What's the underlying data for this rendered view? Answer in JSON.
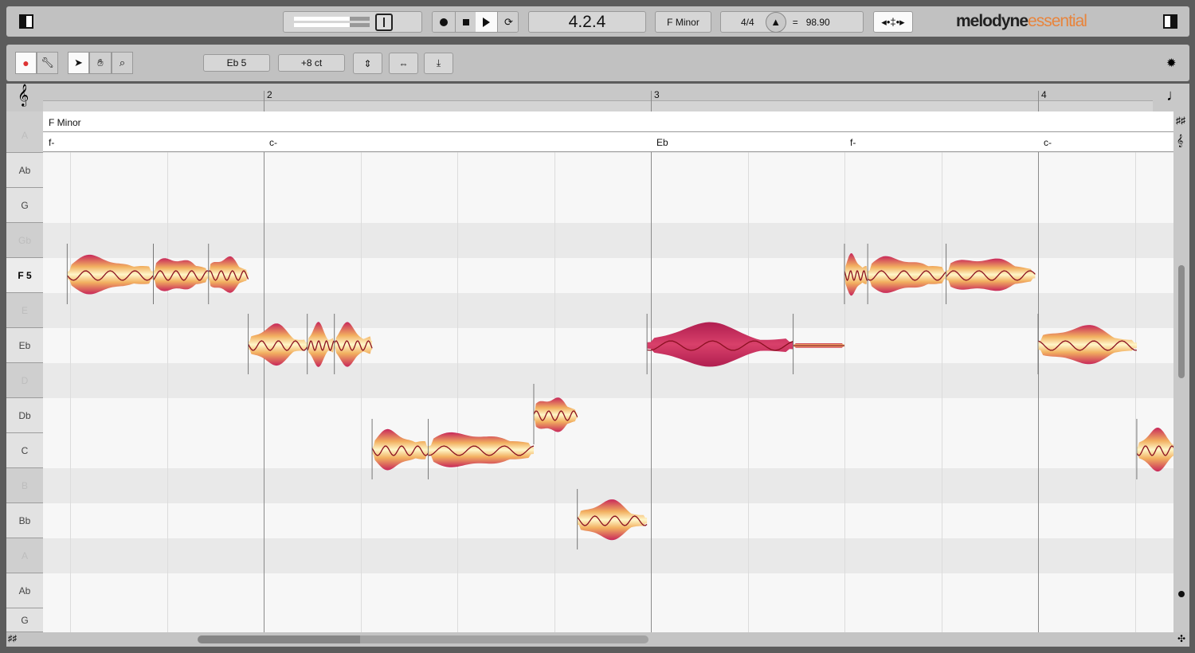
{
  "topbar": {
    "transport": {
      "record": "record-icon",
      "stop": "stop-icon",
      "play": "play-icon",
      "loop": "loop-icon"
    },
    "position": "4.2.4",
    "key": "F Minor",
    "time_signature": "4/4",
    "tempo_equals": "=",
    "tempo": "98.90",
    "logo_main": "melodyne",
    "logo_sub": "essential",
    "colors": {
      "logo_sub": "#e8843c"
    }
  },
  "toolbar": {
    "pitch_value": "Eb 5",
    "cents_value": "+8 ct",
    "tools": [
      "main-tool",
      "wrench-tool",
      "pointer-tool",
      "hand-tool",
      "zoom-tool",
      "pitch-snap",
      "time-handle",
      "amplitude"
    ]
  },
  "ruler": {
    "bars": [
      {
        "label": "2",
        "beat": 4
      },
      {
        "label": "3",
        "beat": 8
      },
      {
        "label": "4",
        "beat": 12
      }
    ]
  },
  "scale_label": "F Minor",
  "chords": [
    {
      "label": "f-",
      "beat": 0
    },
    {
      "label": "c-",
      "beat": 4
    },
    {
      "label": "Eb",
      "beat": 8
    },
    {
      "label": "f-",
      "beat": 10
    },
    {
      "label": "c-",
      "beat": 12
    }
  ],
  "keyboard": [
    {
      "name": "A",
      "in": false
    },
    {
      "name": "Ab",
      "in": true
    },
    {
      "name": "G",
      "in": true
    },
    {
      "name": "Gb",
      "in": false
    },
    {
      "name": "F 5",
      "in": true,
      "selected": true
    },
    {
      "name": "E",
      "in": false
    },
    {
      "name": "Eb",
      "in": true
    },
    {
      "name": "D",
      "in": false
    },
    {
      "name": "Db",
      "in": true
    },
    {
      "name": "C",
      "in": true
    },
    {
      "name": "B",
      "in": false
    },
    {
      "name": "Bb",
      "in": true
    },
    {
      "name": "A",
      "in": false
    },
    {
      "name": "Ab",
      "in": true
    },
    {
      "name": "G",
      "in": true
    }
  ],
  "notes": [
    {
      "pitch": "F 5",
      "start": 1.97,
      "end": 2.86
    },
    {
      "pitch": "F 5",
      "start": 2.86,
      "end": 3.43
    },
    {
      "pitch": "F 5",
      "start": 3.43,
      "end": 3.84
    },
    {
      "pitch": "Eb",
      "start": 3.84,
      "end": 4.45
    },
    {
      "pitch": "Eb",
      "start": 4.45,
      "end": 4.73
    },
    {
      "pitch": "Eb",
      "start": 4.73,
      "end": 5.12
    },
    {
      "pitch": "C",
      "start": 5.12,
      "end": 5.7
    },
    {
      "pitch": "C",
      "start": 5.7,
      "end": 6.79
    },
    {
      "pitch": "Db",
      "start": 6.79,
      "end": 7.24
    },
    {
      "pitch": "Bb",
      "start": 7.24,
      "end": 7.96
    },
    {
      "pitch": "Eb",
      "start": 7.96,
      "end": 9.47,
      "selected": true
    },
    {
      "pitch": "Eb",
      "start": 9.47,
      "end": 10.0,
      "thin": true
    },
    {
      "pitch": "F 5",
      "start": 10.0,
      "end": 10.24
    },
    {
      "pitch": "F 5",
      "start": 10.24,
      "end": 11.05
    },
    {
      "pitch": "F 5",
      "start": 11.05,
      "end": 11.97
    },
    {
      "pitch": "Eb",
      "start": 12.0,
      "end": 13.02
    },
    {
      "pitch": "C",
      "start": 13.02,
      "end": 13.5
    }
  ],
  "colors": {
    "blob_light": "#fff6c8",
    "blob_mid": "#f2b060",
    "blob_dark": "#c8285a",
    "pitch_curve": "#8a1020",
    "selected_blob": "#c42a5c"
  }
}
